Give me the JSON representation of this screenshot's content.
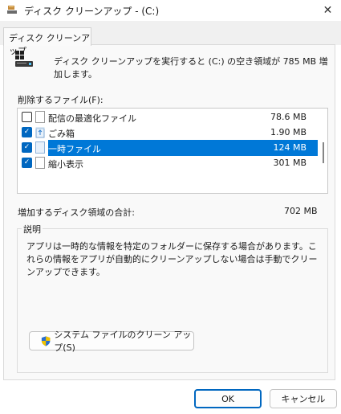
{
  "window": {
    "title": "ディスク クリーンアップ - (C:)",
    "close_glyph": "✕"
  },
  "tab": {
    "label": "ディスク クリーンアップ"
  },
  "header": {
    "text": "ディスク クリーンアップを実行すると (C:) の空き領域が 785 MB 増加します。"
  },
  "files": {
    "label": "削除するファイル(F):",
    "rows": [
      {
        "name": "配信の最適化ファイル",
        "size": "78.6 MB",
        "checked": false,
        "selected": false
      },
      {
        "name": "ごみ箱",
        "size": "1.90 MB",
        "checked": true,
        "selected": false
      },
      {
        "name": "一時ファイル",
        "size": "124 MB",
        "checked": true,
        "selected": true
      },
      {
        "name": "縮小表示",
        "size": "301 MB",
        "checked": true,
        "selected": false
      }
    ]
  },
  "total": {
    "label": "増加するディスク領域の合計:",
    "value": "702 MB"
  },
  "description": {
    "legend": "説明",
    "text": "アプリは一時的な情報を特定のフォルダーに保存する場合があります。これらの情報をアプリが自動的にクリーンアップしない場合は手動でクリーンアップできます。"
  },
  "buttons": {
    "system_cleanup": "システム ファイルのクリーン アップ(S)",
    "ok": "OK",
    "cancel": "キャンセル"
  },
  "colors": {
    "accent": "#0067c0",
    "selection": "#0078d7"
  }
}
